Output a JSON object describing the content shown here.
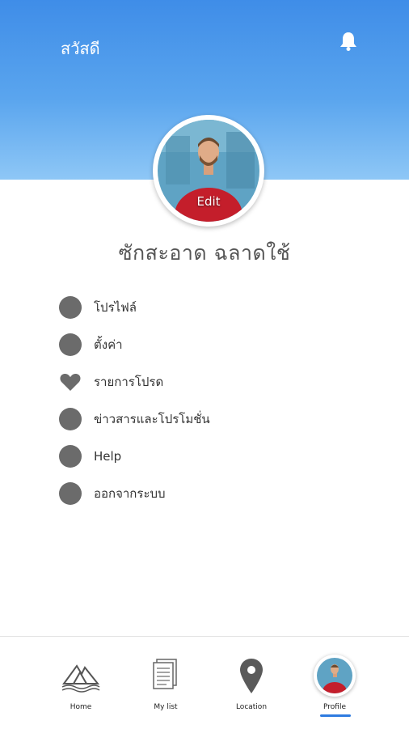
{
  "header": {
    "greeting": "สวัสดี",
    "bell_icon": "bell-icon"
  },
  "profile": {
    "edit_label": "Edit",
    "name": "ซักสะอาด ฉลาดใช้"
  },
  "menu": {
    "items": [
      {
        "label": "โปรไฟล์",
        "icon": "circle-icon"
      },
      {
        "label": "ตั้งค่า",
        "icon": "circle-icon"
      },
      {
        "label": "รายการโปรด",
        "icon": "heart-icon"
      },
      {
        "label": "ข่าวสารและโปรโมชั่น",
        "icon": "circle-icon"
      },
      {
        "label": "Help",
        "icon": "circle-icon"
      },
      {
        "label": "ออกจากระบบ",
        "icon": "circle-icon"
      }
    ]
  },
  "tabbar": {
    "tabs": [
      {
        "label": "Home",
        "icon": "home-logo-icon"
      },
      {
        "label": "My list",
        "icon": "document-icon"
      },
      {
        "label": "Location",
        "icon": "map-pin-icon"
      },
      {
        "label": "Profile",
        "icon": "avatar",
        "active": true
      }
    ]
  },
  "colors": {
    "header_top": "#3f8de8",
    "header_bottom": "#8ec7f6",
    "menu_icon": "#6b6b6b",
    "active_tab": "#2e7be0"
  }
}
